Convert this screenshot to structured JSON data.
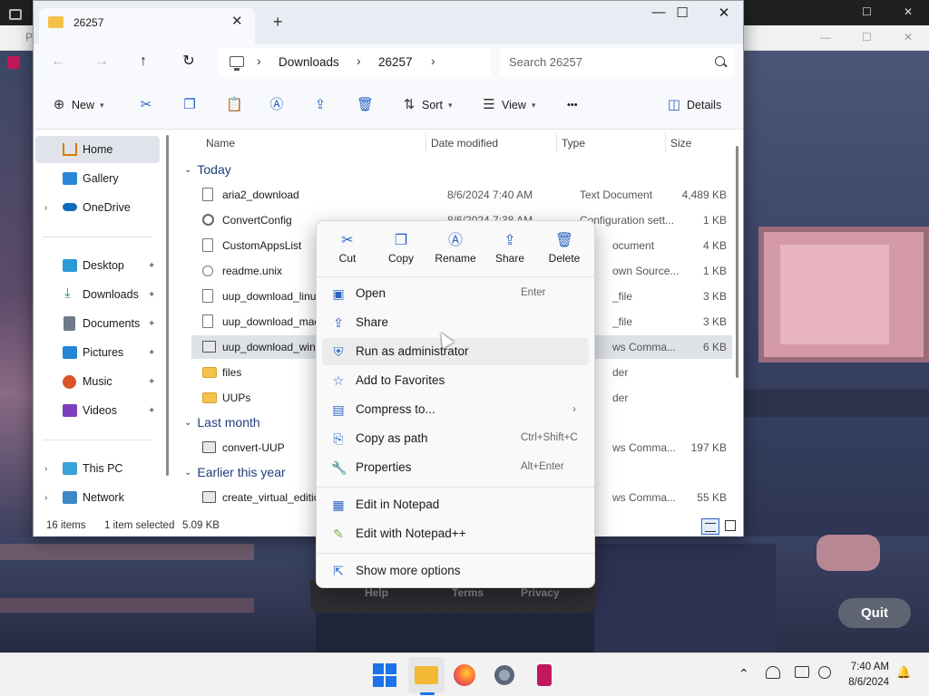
{
  "window": {
    "tab_title": "26257",
    "tab_close_glyph": "✕",
    "new_tab_glyph": "+",
    "minimize_glyph": "—",
    "maximize_glyph": "☐",
    "close_glyph": "✕"
  },
  "nav": {
    "back_glyph": "←",
    "forward_glyph": "→",
    "up_glyph": "↑",
    "refresh_glyph": "↻",
    "breadcrumbs": [
      "Downloads",
      "26257"
    ],
    "crumb_sep": "›",
    "search_placeholder": "Search 26257"
  },
  "toolbar": {
    "new_label": "New",
    "sort_label": "Sort",
    "view_label": "View",
    "more_glyph": "•••",
    "details_label": "Details",
    "cut_icon": "scissors-icon",
    "copy_icon": "copy-icon",
    "paste_icon": "paste-icon",
    "rename_icon": "rename-icon",
    "share_icon": "share-icon",
    "delete_icon": "trash-icon"
  },
  "sidebar": {
    "items": [
      {
        "label": "Home",
        "icon": "home-icon"
      },
      {
        "label": "Gallery",
        "icon": "gallery-icon"
      },
      {
        "label": "OneDrive",
        "icon": "cloud-icon"
      },
      {
        "label": "Desktop",
        "icon": "desktop-icon"
      },
      {
        "label": "Downloads",
        "icon": "download-icon"
      },
      {
        "label": "Documents",
        "icon": "documents-icon"
      },
      {
        "label": "Pictures",
        "icon": "pictures-icon"
      },
      {
        "label": "Music",
        "icon": "music-icon"
      },
      {
        "label": "Videos",
        "icon": "videos-icon"
      },
      {
        "label": "This PC",
        "icon": "pc-icon"
      },
      {
        "label": "Network",
        "icon": "network-icon"
      }
    ],
    "pin_glyph": "📌",
    "expand_glyph": "›"
  },
  "columns": {
    "name": "Name",
    "date": "Date modified",
    "type": "Type",
    "size": "Size"
  },
  "groups": {
    "today": "Today",
    "last_month": "Last month",
    "earlier": "Earlier this year",
    "chevron": "⌄"
  },
  "files": [
    {
      "name": "aria2_download",
      "date": "8/6/2024 7:40 AM",
      "type": "Text Document",
      "size": "4,489 KB"
    },
    {
      "name": "ConvertConfig",
      "date": "8/6/2024 7:38 AM",
      "type": "Configuration sett...",
      "size": "1 KB"
    },
    {
      "name": "CustomAppsList",
      "date": "",
      "type": "ocument",
      "size": "4 KB"
    },
    {
      "name": "readme.unix",
      "date": "",
      "type": "own Source...",
      "size": "1 KB"
    },
    {
      "name": "uup_download_linux.s",
      "date": "",
      "type": "_file",
      "size": "3 KB"
    },
    {
      "name": "uup_download_maco",
      "date": "",
      "type": "_file",
      "size": "3 KB"
    },
    {
      "name": "uup_download_windo",
      "date": "",
      "type": "ws Comma...",
      "size": "6 KB"
    },
    {
      "name": "files",
      "date": "",
      "type": "der",
      "size": ""
    },
    {
      "name": "UUPs",
      "date": "",
      "type": "der",
      "size": ""
    },
    {
      "name": "convert-UUP",
      "date": "",
      "type": "ws Comma...",
      "size": "197 KB"
    },
    {
      "name": "create_virtual_editions",
      "date": "",
      "type": "ws Comma...",
      "size": "55 KB"
    }
  ],
  "status": {
    "items": "16 items",
    "selected": "1 item selected",
    "size": "5.09 KB"
  },
  "context_menu": {
    "quick": [
      {
        "label": "Cut",
        "glyph": "✂"
      },
      {
        "label": "Copy",
        "glyph": "❐"
      },
      {
        "label": "Rename",
        "glyph": "Ⓐ"
      },
      {
        "label": "Share",
        "glyph": "⇪"
      },
      {
        "label": "Delete",
        "glyph": "🗑"
      }
    ],
    "items": [
      {
        "label": "Open",
        "shortcut": "Enter",
        "glyph": "▣"
      },
      {
        "label": "Share",
        "shortcut": "",
        "glyph": "⇪"
      },
      {
        "label": "Run as administrator",
        "shortcut": "",
        "glyph": "⛨"
      },
      {
        "label": "Add to Favorites",
        "shortcut": "",
        "glyph": "☆"
      },
      {
        "label": "Compress to...",
        "shortcut": "",
        "glyph": "▤",
        "arrow": "›"
      },
      {
        "label": "Copy as path",
        "shortcut": "Ctrl+Shift+C",
        "glyph": "⎘"
      },
      {
        "label": "Properties",
        "shortcut": "Alt+Enter",
        "glyph": "🔧"
      },
      {
        "label": "Edit in Notepad",
        "shortcut": "",
        "glyph": "▦"
      },
      {
        "label": "Edit with Notepad++",
        "shortcut": "",
        "glyph": "✎"
      },
      {
        "label": "Show more options",
        "shortcut": "",
        "glyph": "⇱"
      }
    ]
  },
  "background": {
    "quit_label": "Quit",
    "overlay_links": [
      "Help",
      "Terms",
      "Privacy"
    ],
    "back_min_glyph": "—",
    "back_max_glyph": "☐",
    "back_close_glyph": "✕",
    "back_title_initial": "P"
  },
  "taskbar": {
    "time": "7:40 AM",
    "date": "8/6/2024",
    "chevron_up_glyph": "⌃",
    "bell_glyph": "🔔"
  },
  "colors": {
    "accent": "#1a73e8",
    "folder": "#f4c14a",
    "selection": "#dfe3e8"
  }
}
